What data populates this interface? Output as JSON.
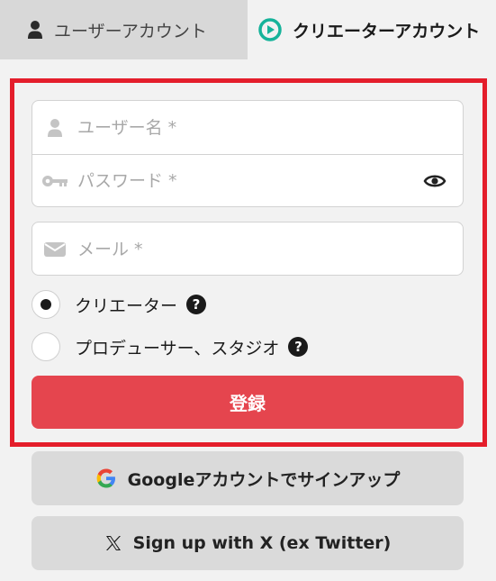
{
  "tabs": {
    "user": {
      "label": "ユーザーアカウント",
      "icon": "person-icon"
    },
    "creator": {
      "label": "クリエーターアカウント",
      "icon": "play-circle-icon",
      "accent": "#16b39a"
    }
  },
  "form": {
    "username": {
      "placeholder": "ユーザー名 *",
      "icon": "user-icon"
    },
    "password": {
      "placeholder": "パスワード *",
      "icon": "key-icon",
      "toggle_icon": "eye-icon"
    },
    "email": {
      "placeholder": "メール *",
      "icon": "envelope-icon"
    },
    "roles": [
      {
        "label": "クリエーター",
        "selected": true,
        "help": "?"
      },
      {
        "label": "プロデューサー、スタジオ",
        "selected": false,
        "help": "?"
      }
    ],
    "register_label": "登録"
  },
  "social": {
    "google_label": "Googleアカウントでサインアップ",
    "x_label": "Sign up with X (ex Twitter)"
  },
  "colors": {
    "highlight_frame": "#e41e2b",
    "register_button": "#e5454e",
    "social_button": "#dadada"
  }
}
